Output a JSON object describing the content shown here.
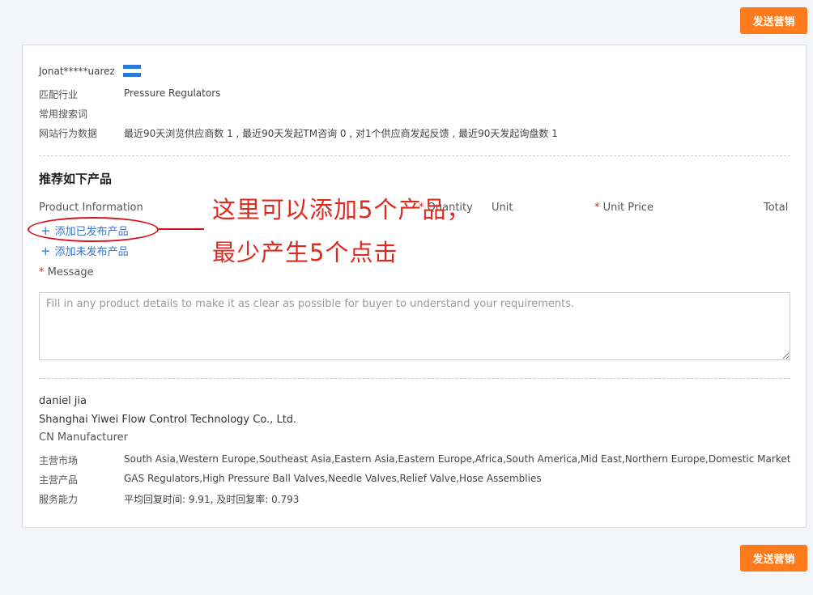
{
  "actions": {
    "send_label": "发送营销"
  },
  "buyer": {
    "name": "Jonat*****uarez",
    "flag_icon": "honduras-flag-icon",
    "rows": [
      {
        "label": "匹配行业",
        "value": "Pressure Regulators"
      },
      {
        "label": "常用搜索词",
        "value": ""
      },
      {
        "label": "网站行为数据",
        "value": "最近90天浏览供应商数 1 , 最近90天发起TM咨询 0 , 对1个供应商发起反馈 , 最近90天发起询盘数 1"
      }
    ]
  },
  "recommend": {
    "title": "推荐如下产品",
    "columns": {
      "product": "Product Information",
      "quantity": "Quantity",
      "unit": "Unit",
      "unit_price": "Unit Price",
      "total": "Total",
      "required_mark": "*"
    },
    "add_published": "添加已发布产品",
    "add_unpublished": "添加未发布产品"
  },
  "message": {
    "label": "Message",
    "placeholder": "Fill in any product details to make it as clear as possible for buyer to understand your requirements.",
    "value": ""
  },
  "seller": {
    "contact": "daniel jia",
    "company": "Shanghai Yiwei Flow Control Technology Co., Ltd.",
    "type": "CN Manufacturer",
    "rows": [
      {
        "label": "主营市场",
        "value": "South Asia,Western Europe,Southeast Asia,Eastern Asia,Eastern Europe,Africa,South America,Mid East,Northern Europe,Domestic Market"
      },
      {
        "label": "主营产品",
        "value": "GAS Regulators,High Pressure Ball Valves,Needle Valves,Relief Valve,Hose Assemblies"
      },
      {
        "label": "服务能力",
        "value": "平均回复时间: 9.91, 及时回复率: 0.793"
      }
    ]
  },
  "annotation": {
    "line1": "这里可以添加5个产品，",
    "line2": "最少产生5个点击"
  },
  "colors": {
    "accent": "#ff7a1a",
    "link": "#3b74c7",
    "annotation": "#e0291e"
  }
}
